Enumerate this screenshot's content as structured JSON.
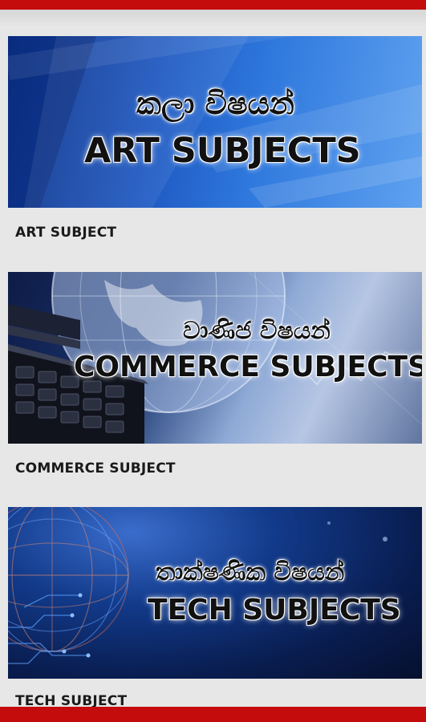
{
  "colors": {
    "bars": "#c40c0c",
    "background": "#e7e7e7",
    "label_text": "#1a1a1a"
  },
  "subjects": [
    {
      "banner_sinhala": "කලා විෂයන්",
      "banner_english": "ART SUBJECTS",
      "label": "ART SUBJECT"
    },
    {
      "banner_sinhala": "වාණිජ විෂයන්",
      "banner_english": "COMMERCE SUBJECTS",
      "label": "COMMERCE SUBJECT"
    },
    {
      "banner_sinhala": "තාක්ෂණික විෂයන්",
      "banner_english": "TECH SUBJECTS",
      "label": "TECH SUBJECT"
    }
  ]
}
